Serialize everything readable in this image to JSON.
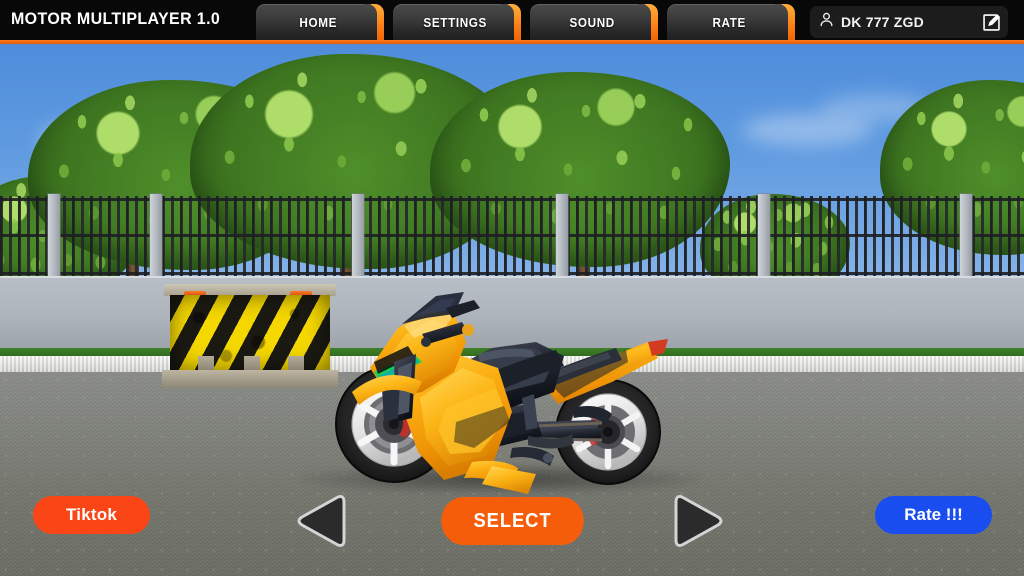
{
  "app": {
    "title": "MOTOR MULTIPLAYER 1.0",
    "accent_orange": "#ff7b1c",
    "topbar_bg": "#080808"
  },
  "topbar": {
    "tabs": [
      {
        "label": "HOME",
        "icon": "home-icon"
      },
      {
        "label": "SETTINGS",
        "icon": "gear-icon"
      },
      {
        "label": "SOUND",
        "icon": "speaker-icon"
      },
      {
        "label": "RATE",
        "icon": "star-icon"
      }
    ],
    "user": {
      "icon": "person-icon",
      "name": "DK 777 ZGD",
      "edit_icon": "edit-pencil-icon"
    }
  },
  "scene": {
    "description": "3D motorcycle showroom — yellow sport bike parked on asphalt in front of a metal fence",
    "vehicle": {
      "type": "sport-motorcycle",
      "body_color": "#f5a30d",
      "accent_color": "#0f1118",
      "wheel_color": "#f2f2f2",
      "decal_color": "#35d94a"
    },
    "props": {
      "barrier": "yellow-black-hazard-barrier",
      "fence": "dark-metal-vertical-bar-fence",
      "trees": "green-leafy-trees",
      "sky": "#5f9ae0",
      "ground": "#7a7c74"
    }
  },
  "controls": {
    "tiktok_label": "Tiktok",
    "tiktok_color": "#fa4616",
    "prev_icon": "arrow-left-icon",
    "select_label": "SELECT",
    "select_color": "#f55d0b",
    "next_icon": "arrow-right-icon",
    "rate_label": "Rate !!!",
    "rate_color": "#1a4df0"
  }
}
